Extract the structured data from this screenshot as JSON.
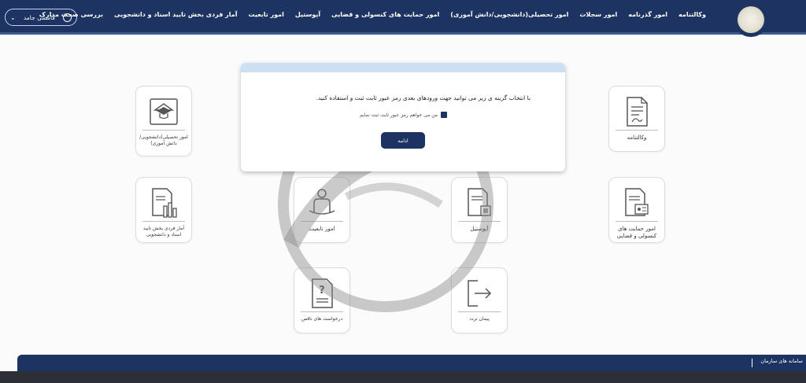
{
  "header": {
    "user_name": "قاسمی جامد",
    "nav": [
      "وکالتنامه",
      "امور گذرنامه",
      "امور سجلات",
      "امور تحصیلی(دانشجویی/دانش آموزی)",
      "امور حمایت های کنسولی و قضایی",
      "آپوستیل",
      "امور تابعیت",
      "آمار فردی بخش تایید اسناد و دانشجویی",
      "بررسی صحت مدارک"
    ]
  },
  "modal": {
    "message": "با انتخاب گزینه ی زیر می توانید جهت ورودهای بعدی رمز عبور ثابت ثبت و استفاده کنید.",
    "checkbox_label": "من می خواهم رمز عبور ثابت ثبت نمایم",
    "continue_label": "ادامه"
  },
  "tiles": {
    "education": "امور تحصیلی(دانشجویی/ دانش آموزی)",
    "power_of_attorney": "وکالتنامه",
    "stats": "آمار فردی بخش تایید اسناد و دانشجویی",
    "nationality": "امور تابعیت",
    "apostille": "آپوستیل",
    "consular": "امور حمایت های کنسولی و قضایی",
    "requests": "درخواست های ناقص",
    "exit": "پیمان تردد"
  },
  "footer": {
    "label": "سامانه های سازمان"
  },
  "colors": {
    "navy": "#1d3463",
    "modal_header": "#cde0f3"
  }
}
